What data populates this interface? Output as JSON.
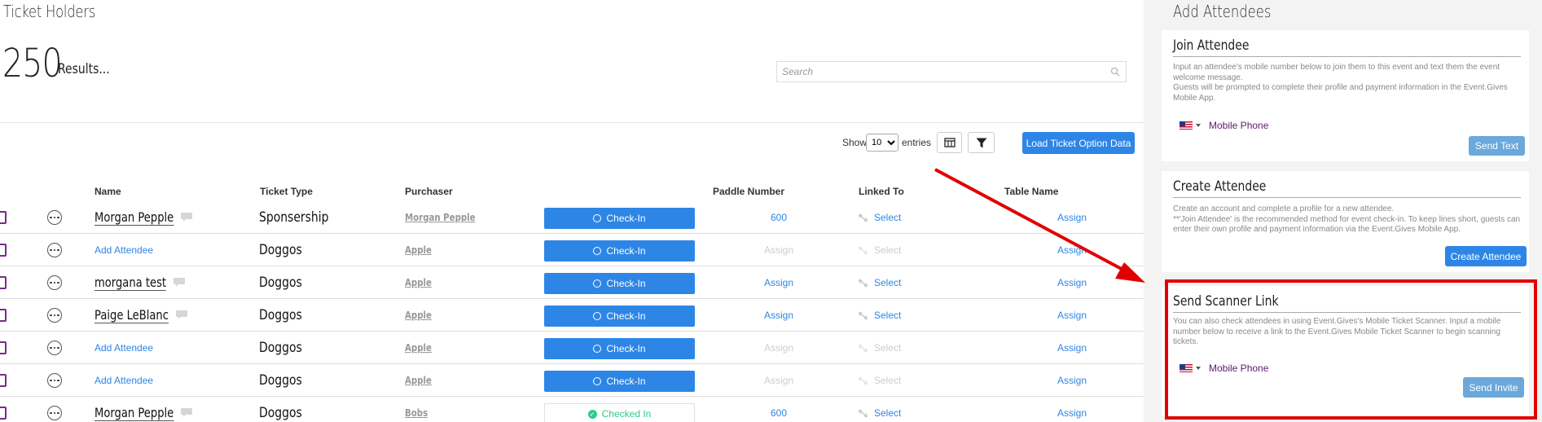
{
  "left": {
    "title": "Ticket Holders",
    "results_count": "250",
    "results_label": "Results...",
    "search_placeholder": "Search",
    "show_label": "Show",
    "entries_value": "10",
    "entries_label": "entries",
    "load_button": "Load Ticket Option Data",
    "columns": {
      "name": "Name",
      "ticket_type": "Ticket Type",
      "purchaser": "Purchaser",
      "paddle_number": "Paddle Number",
      "linked_to": "Linked To",
      "table_name": "Table Name"
    },
    "rows": [
      {
        "name": "Morgan Pepple",
        "is_link": false,
        "chat": true,
        "ticket_type": "Sponsership",
        "purchaser": "Morgan Pepple",
        "checkin": "Check-In",
        "checked": false,
        "paddle": "600",
        "paddle_dim": false,
        "linked": "Select",
        "linked_dim": false,
        "table": "Assign"
      },
      {
        "name": "Add Attendee",
        "is_link": true,
        "chat": false,
        "ticket_type": "Doggos",
        "purchaser": "Apple",
        "checkin": "Check-In",
        "checked": false,
        "paddle": "Assign",
        "paddle_dim": true,
        "linked": "Select",
        "linked_dim": true,
        "table": "Assign"
      },
      {
        "name": "morgana test",
        "is_link": false,
        "chat": true,
        "ticket_type": "Doggos",
        "purchaser": "Apple",
        "checkin": "Check-In",
        "checked": false,
        "paddle": "Assign",
        "paddle_dim": false,
        "linked": "Select",
        "linked_dim": false,
        "table": "Assign"
      },
      {
        "name": "Paige LeBlanc",
        "is_link": false,
        "chat": true,
        "ticket_type": "Doggos",
        "purchaser": "Apple",
        "checkin": "Check-In",
        "checked": false,
        "paddle": "Assign",
        "paddle_dim": false,
        "linked": "Select",
        "linked_dim": false,
        "table": "Assign"
      },
      {
        "name": "Add Attendee",
        "is_link": true,
        "chat": false,
        "ticket_type": "Doggos",
        "purchaser": "Apple",
        "checkin": "Check-In",
        "checked": false,
        "paddle": "Assign",
        "paddle_dim": true,
        "linked": "Select",
        "linked_dim": true,
        "table": "Assign"
      },
      {
        "name": "Add Attendee",
        "is_link": true,
        "chat": false,
        "ticket_type": "Doggos",
        "purchaser": "Apple",
        "checkin": "Check-In",
        "checked": false,
        "paddle": "Assign",
        "paddle_dim": true,
        "linked": "Select",
        "linked_dim": true,
        "table": "Assign"
      },
      {
        "name": "Morgan Pepple",
        "is_link": false,
        "chat": true,
        "ticket_type": "Doggos",
        "purchaser": "Bobs",
        "checkin": "Checked In",
        "checked": true,
        "paddle": "600",
        "paddle_dim": false,
        "linked": "Select",
        "linked_dim": false,
        "table": "Assign"
      }
    ]
  },
  "right": {
    "title": "Add Attendees",
    "join": {
      "title": "Join Attendee",
      "desc1": "Input an attendee's mobile number below to join them to this event and text them the event welcome message.",
      "desc2": "Guests will be prompted to complete their profile and payment information in the Event.Gives Mobile App.",
      "phone_placeholder": "Mobile Phone",
      "button": "Send Text"
    },
    "create": {
      "title": "Create Attendee",
      "desc1": "Create an account and complete a profile for a new attendee.",
      "desc2": "**'Join Attendee' is the recommended method for event check-in. To keep lines short, guests can enter their own profile and payment information via the Event.Gives Mobile App.",
      "button": "Create Attendee"
    },
    "scanner": {
      "title": "Send Scanner Link",
      "desc": "You can also check attendees in using Event.Gives's Mobile Ticket Scanner. Input a mobile number below to receive a link to the Event.Gives Mobile Ticket Scanner to begin scanning tickets.",
      "phone_placeholder": "Mobile Phone",
      "button": "Send Invite"
    }
  },
  "colors": {
    "accent": "#2d86e6",
    "muted_button": "#6ba8dc",
    "highlight": "#e00000",
    "checked": "#2ecc88"
  }
}
